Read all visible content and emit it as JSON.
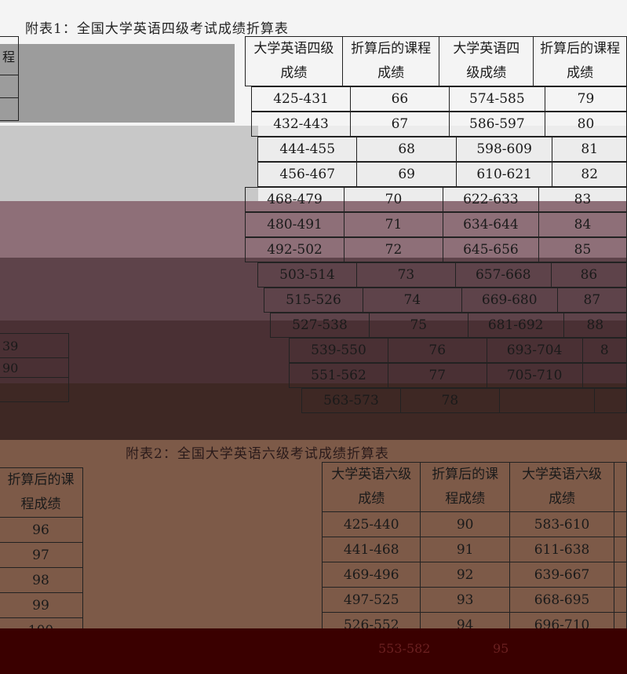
{
  "title1": "附表1：全国大学英语四级考试成绩折算表",
  "title2": "附表2：全国大学英语六级考试成绩折算表",
  "table1": {
    "headers": [
      [
        "大学英语四级",
        "成绩"
      ],
      [
        "折算后的课程",
        "成绩"
      ],
      [
        "大学英语四",
        "级成绩"
      ],
      [
        "折算后的课程",
        "成绩"
      ]
    ],
    "rows": [
      [
        "425-431",
        "66",
        "574-585",
        "79"
      ],
      [
        "432-443",
        "67",
        "586-597",
        "80"
      ],
      [
        "444-455",
        "68",
        "598-609",
        "81"
      ],
      [
        "456-467",
        "69",
        "610-621",
        "82"
      ],
      [
        "468-479",
        "70",
        "622-633",
        "83"
      ],
      [
        "480-491",
        "71",
        "634-644",
        "84"
      ],
      [
        "492-502",
        "72",
        "645-656",
        "85"
      ],
      [
        "503-514",
        "73",
        "657-668",
        "86"
      ],
      [
        "515-526",
        "74",
        "669-680",
        "87"
      ],
      [
        "527-538",
        "75",
        "681-692",
        "88"
      ],
      [
        "539-550",
        "76",
        "693-704",
        "8"
      ],
      [
        "551-562",
        "77",
        "705-710",
        ""
      ],
      [
        "563-573",
        "78",
        "",
        ""
      ]
    ]
  },
  "left_fragments": {
    "top_partial": "程",
    "partial_a": "39",
    "partial_b": "90"
  },
  "table2_left": {
    "header": [
      "折算后的课",
      "程成绩"
    ],
    "values": [
      "96",
      "97",
      "98",
      "99",
      "100"
    ]
  },
  "table2": {
    "headers": [
      [
        "大学英语六级",
        "成绩"
      ],
      [
        "折算后的课",
        "程成绩"
      ],
      [
        "大学英语六级",
        "成绩"
      ]
    ],
    "rows": [
      [
        "425-440",
        "90",
        "583-610"
      ],
      [
        "441-468",
        "91",
        "611-638"
      ],
      [
        "469-496",
        "92",
        "639-667"
      ],
      [
        "497-525",
        "93",
        "668-695"
      ],
      [
        "526-552",
        "94",
        "696-710"
      ],
      [
        "553-582",
        "95",
        ""
      ]
    ]
  }
}
